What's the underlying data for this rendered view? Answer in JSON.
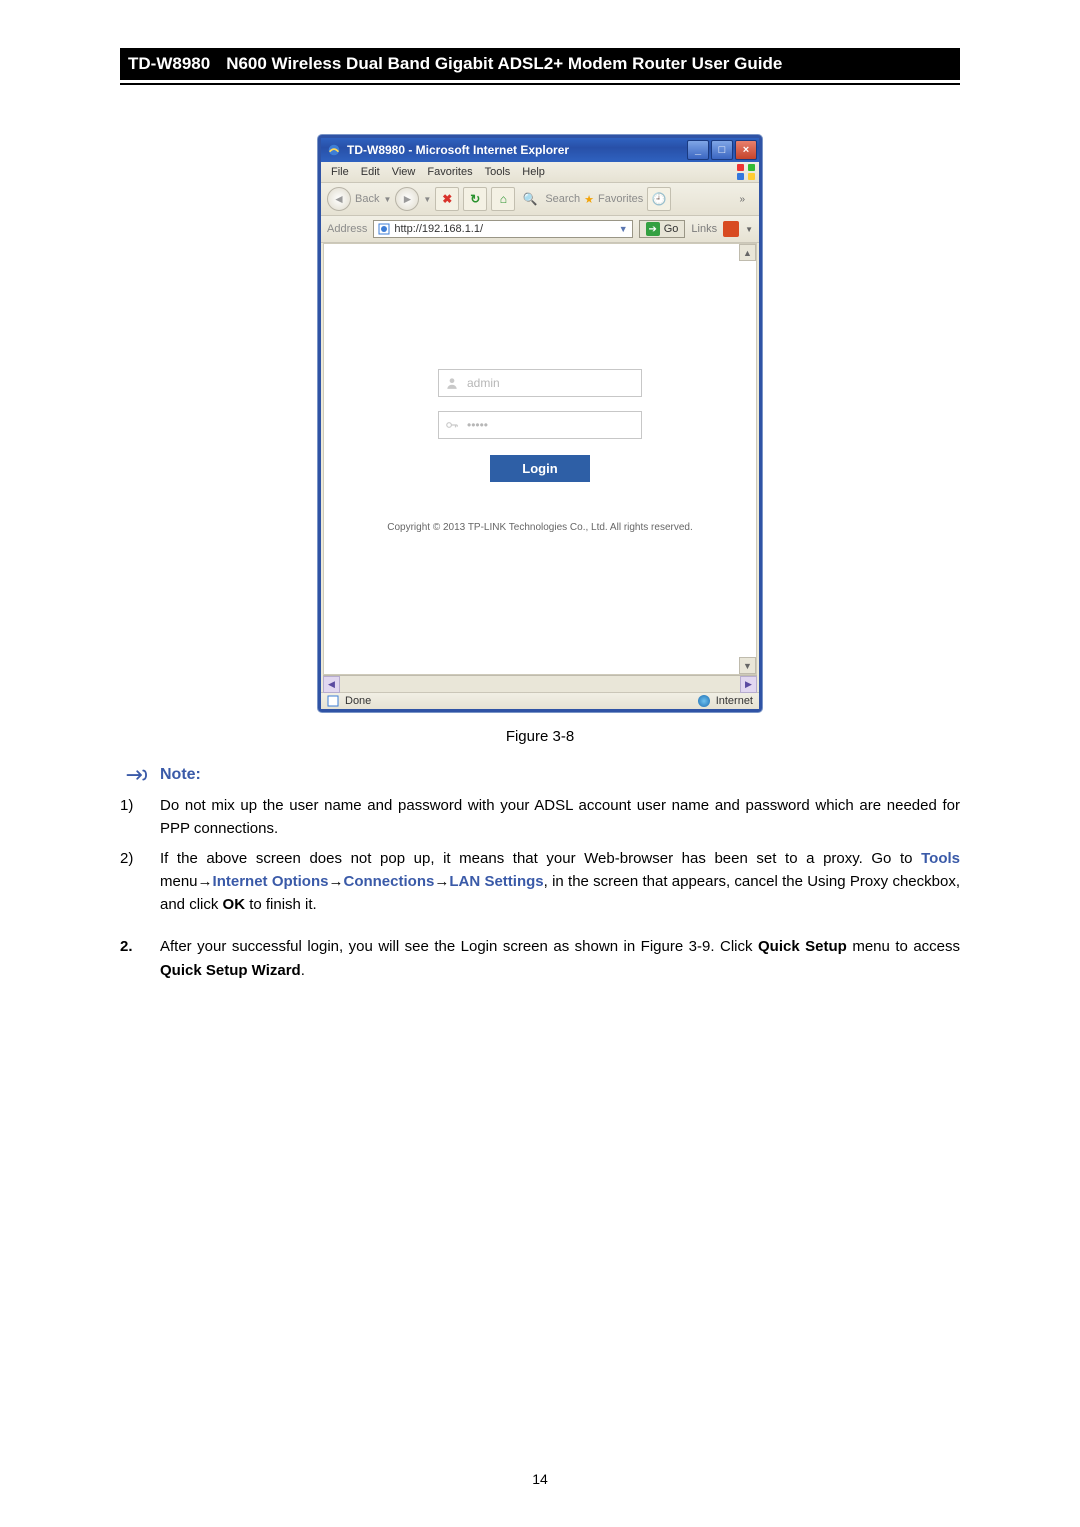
{
  "header": {
    "model": "TD-W8980",
    "title": "N600 Wireless Dual Band Gigabit ADSL2+ Modem Router User Guide"
  },
  "ie": {
    "window_title": "TD-W8980 - Microsoft Internet Explorer",
    "menus": [
      "File",
      "Edit",
      "View",
      "Favorites",
      "Tools",
      "Help"
    ],
    "back_label": "Back",
    "search_label": "Search",
    "favorites_label": "Favorites",
    "more_glyph": "»",
    "address_label": "Address",
    "url": "http://192.168.1.1/",
    "go_label": "Go",
    "links_label": "Links",
    "username_placeholder": "admin",
    "password_placeholder": "•••••",
    "login_label": "Login",
    "copyright": "Copyright © 2013 TP-LINK Technologies Co., Ltd. All rights reserved.",
    "status_done": "Done",
    "status_zone": "Internet"
  },
  "figure_caption": "Figure 3-8",
  "note": {
    "heading": "Note:",
    "items": [
      {
        "num": "1)",
        "text": "Do not mix up the user name and password with your ADSL account user name and password which are needed for PPP connections."
      },
      {
        "num": "2)",
        "prefix": "If the above screen does not pop up, it means that your Web-browser has been set to a proxy. Go to ",
        "b1": "Tools",
        " mid1": " menu→",
        "b2": "Internet Options",
        " mid2": "→",
        "b3": "Connections",
        " mid3": "→",
        "b4": "LAN Settings",
        " suffix": ", in the screen that appears, cancel the Using Proxy checkbox, and click ",
        "b5": "OK",
        " tail": " to finish it."
      }
    ]
  },
  "step2": {
    "num": "2.",
    "pre": "After your successful login, you will see the Login screen as shown in Figure 3-9. Click ",
    "b1": "Quick Setup",
    "mid": " menu to access ",
    "b2": "Quick Setup Wizard",
    "tail": "."
  },
  "page_number": "14"
}
